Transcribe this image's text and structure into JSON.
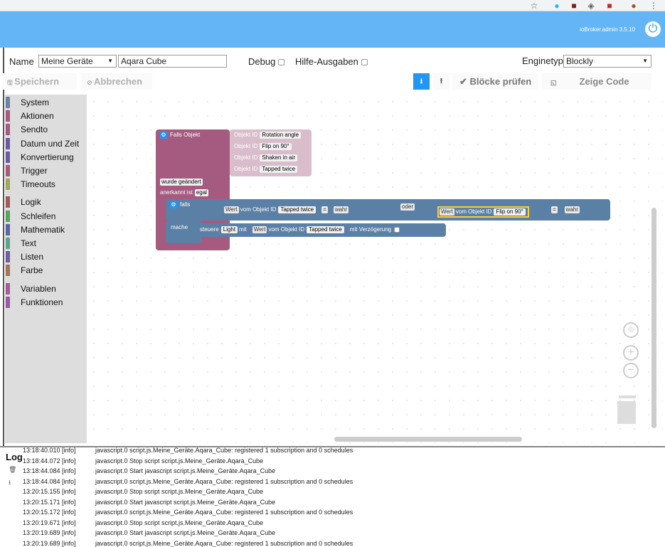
{
  "header": {
    "version": "ioBroker.admin 3.5.10",
    "power_icon": "power-icon"
  },
  "editor": {
    "name_label": "Name",
    "folder": "Meine Geräte",
    "script_name": "Aqara Cube",
    "debug_label": "Debug",
    "hilfe_label": "Hilfe-Ausgaben",
    "engine_label": "Enginetyp",
    "engine_value": "Blockly",
    "save": "Speichern",
    "cancel": "Abbrechen",
    "check": "Blöcke prüfen",
    "show_code": "Zeige Code"
  },
  "categories": [
    {
      "label": "System",
      "color": "#6a84a7"
    },
    {
      "label": "Aktionen",
      "color": "#a55b80"
    },
    {
      "label": "Sendto",
      "color": "#a55b80"
    },
    {
      "label": "Datum und Zeit",
      "color": "#6b5ba5"
    },
    {
      "label": "Konvertierung",
      "color": "#6b5ba5"
    },
    {
      "label": "Trigger",
      "color": "#a55b80"
    },
    {
      "label": "Timeouts",
      "color": "#a5a55b"
    },
    {
      "label": "Logik",
      "color": "#a55b5b"
    },
    {
      "label": "Schleifen",
      "color": "#5ba55b"
    },
    {
      "label": "Mathematik",
      "color": "#5b67a5"
    },
    {
      "label": "Text",
      "color": "#5ba58c"
    },
    {
      "label": "Listen",
      "color": "#745ba5"
    },
    {
      "label": "Farbe",
      "color": "#a5745b"
    },
    {
      "label": "Variablen",
      "color": "#a55b99"
    },
    {
      "label": "Funktionen",
      "color": "#995ba5"
    }
  ],
  "blocks": {
    "trigger_title": "Falls Objekt",
    "objid": "Objekt ID",
    "objects": [
      "Rotation angle",
      "Flip on 90°",
      "Shaken in air",
      "Tapped twice"
    ],
    "changed": "wurde geändert",
    "ack_label": "anerkannt ist",
    "ack_value": "egal",
    "if_label": "falls",
    "wert": "Wert",
    "vom": "vom Objekt ID",
    "obj1": "Tapped twice",
    "eq": "=",
    "true1": "wahr",
    "or": "oder",
    "obj2": "Flip on 90°",
    "true2": "wahr",
    "do_label": "mache",
    "control": "steuere",
    "light": "Light",
    "mit": "mit",
    "obj3": "Tapped twice",
    "delay": "mit Verzögerung"
  },
  "log": {
    "title": "Log",
    "rows": [
      {
        "time": "13:18:40.010  [info]",
        "msg": "javascript.0 script.js.Meine_Geräte.Aqara_Cube: registered 1 subscription and 0 schedules"
      },
      {
        "time": "13:18:44.072  [info]",
        "msg": "javascript.0 Stop script script.js.Meine_Geräte.Aqara_Cube"
      },
      {
        "time": "13:18:44.084  [info]",
        "msg": "javascript.0 Start javascript script.js.Meine_Geräte.Aqara_Cube"
      },
      {
        "time": "13:18:44.084  [info]",
        "msg": "javascript.0 script.js.Meine_Geräte.Aqara_Cube: registered 1 subscription and 0 schedules"
      },
      {
        "time": "13:20:15.155  [info]",
        "msg": "javascript.0 Stop script script.js.Meine_Geräte.Aqara_Cube"
      },
      {
        "time": "13:20:15.171  [info]",
        "msg": "javascript.0 Start javascript script.js.Meine_Geräte.Aqara_Cube"
      },
      {
        "time": "13:20:15.172  [info]",
        "msg": "javascript.0 script.js.Meine_Geräte.Aqara_Cube: registered 1 subscription and 0 schedules"
      },
      {
        "time": "13:20:19.671  [info]",
        "msg": "javascript.0 Stop script script.js.Meine_Geräte.Aqara_Cube"
      },
      {
        "time": "13:20:19.689  [info]",
        "msg": "javascript.0 Start javascript script.js.Meine_Geräte.Aqara_Cube"
      },
      {
        "time": "13:20:19.689  [info]",
        "msg": "javascript.0 script.js.Meine_Geräte.Aqara_Cube: registered 1 subscription and 0 schedules"
      }
    ]
  }
}
